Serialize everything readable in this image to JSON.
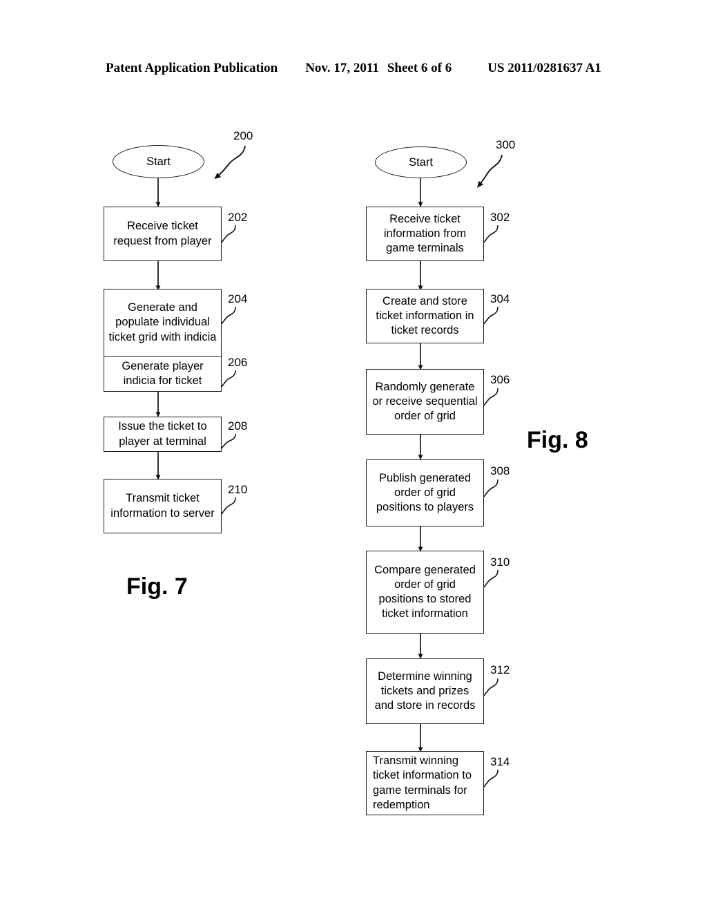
{
  "header": {
    "publication": "Patent Application Publication",
    "date": "Nov. 17, 2011",
    "sheet": "Sheet 6 of 6",
    "patent_number": "US 2011/0281637 A1"
  },
  "figures": [
    {
      "caption": "Fig. 7",
      "diagram_ref": "200",
      "start_label": "Start",
      "steps": [
        {
          "ref": "202",
          "text": "Receive ticket request from player"
        },
        {
          "ref": "204",
          "text": "Generate and populate individual ticket grid with indicia"
        },
        {
          "ref": "206",
          "text": "Generate player indicia for ticket"
        },
        {
          "ref": "208",
          "text": "Issue the ticket to player at terminal"
        },
        {
          "ref": "210",
          "text": "Transmit ticket information to server"
        }
      ]
    },
    {
      "caption": "Fig. 8",
      "diagram_ref": "300",
      "start_label": "Start",
      "steps": [
        {
          "ref": "302",
          "text": "Receive ticket information from game terminals"
        },
        {
          "ref": "304",
          "text": "Create and store ticket information in ticket records"
        },
        {
          "ref": "306",
          "text": "Randomly generate or receive sequential order of grid"
        },
        {
          "ref": "308",
          "text": "Publish generated order of grid positions to players"
        },
        {
          "ref": "310",
          "text": "Compare generated order of grid positions to stored ticket information"
        },
        {
          "ref": "312",
          "text": "Determine winning tickets and prizes and store in records"
        },
        {
          "ref": "314",
          "text": "Transmit winning ticket information to game terminals for redemption"
        }
      ]
    }
  ]
}
